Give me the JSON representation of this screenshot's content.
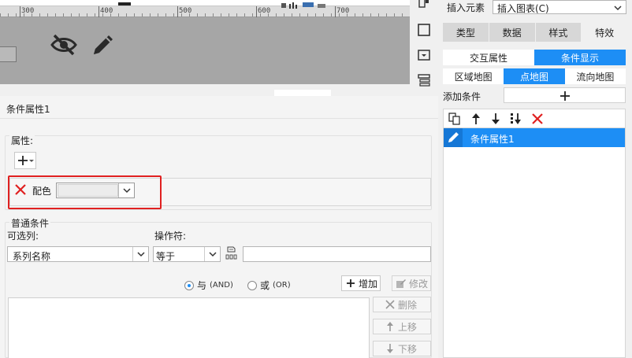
{
  "ruler": {
    "labels": [
      "300",
      "400",
      "500",
      "600",
      "700"
    ]
  },
  "dialog": {
    "title": "条件属性1",
    "props_label": "属性:",
    "prop_name": "配色",
    "cond_section": "普通条件",
    "column_label": "可选列:",
    "operator_label": "操作符:",
    "column_value": "系列名称",
    "operator_value": "等于",
    "and_main": "与",
    "and_sub": "(AND)",
    "or_main": "或",
    "or_sub": "(OR)",
    "add_label": "增加",
    "modify_label": "修改",
    "delete_label": "删除",
    "up_label": "上移",
    "down_label": "下移"
  },
  "right": {
    "insert_label": "插入元素",
    "insert_value": "插入图表(C)",
    "main_tabs": [
      "类型",
      "数据",
      "样式",
      "特效"
    ],
    "sub_tabs": [
      "交互属性",
      "条件显示"
    ],
    "map_tabs": [
      "区域地图",
      "点地图",
      "流向地图"
    ],
    "add_cond_label": "添加条件",
    "cond_item": "条件属性1"
  },
  "colors": {
    "accent": "#1d8ef5",
    "highlight": "#e02020",
    "danger": "#e02020"
  }
}
